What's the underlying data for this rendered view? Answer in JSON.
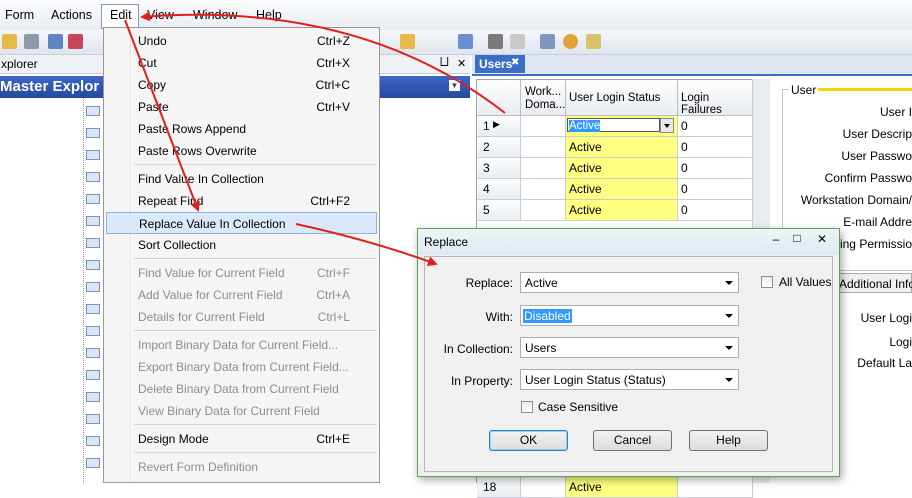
{
  "menubar": {
    "items": [
      "Form",
      "Actions",
      "Edit",
      "View",
      "Window",
      "Help"
    ]
  },
  "explorer": {
    "header_label": "xplorer",
    "pin_glyph": "⨆",
    "close_glyph": "✕",
    "title": "Master Explor",
    "dropdown_glyph": "▼"
  },
  "tabs": {
    "users_label": "Users",
    "close_glyph": "✖"
  },
  "grid": {
    "columns": [
      "",
      "Work... Doma...",
      "User Login Status",
      "Login Failures"
    ],
    "rows": [
      {
        "num": "1",
        "status": "Active",
        "failures": "0"
      },
      {
        "num": "2",
        "status": "Active",
        "failures": "0"
      },
      {
        "num": "3",
        "status": "Active",
        "failures": "0"
      },
      {
        "num": "4",
        "status": "Active",
        "failures": "0"
      },
      {
        "num": "5",
        "status": "Active",
        "failures": "0"
      },
      {
        "num": "18",
        "status": "Active",
        "failures": ""
      }
    ],
    "row_indicator": "▶"
  },
  "user_panel": {
    "group_title": "User",
    "fields": [
      "User I",
      "User Descrip",
      "User Passwo",
      "Confirm Passwo",
      "Workstation Domain/",
      "E-mail Addre",
      "diting Permissio"
    ],
    "additional_tab": "Additional Info",
    "lower_fields": [
      "User Logi",
      "Logi",
      "Default La"
    ]
  },
  "edit_menu": {
    "items": [
      {
        "label": "Undo",
        "shortcut": "Ctrl+Z",
        "disabled": false
      },
      {
        "label": "Cut",
        "shortcut": "Ctrl+X",
        "disabled": false
      },
      {
        "label": "Copy",
        "shortcut": "Ctrl+C",
        "disabled": false
      },
      {
        "label": "Paste",
        "shortcut": "Ctrl+V",
        "disabled": false
      },
      {
        "label": "Paste Rows Append",
        "shortcut": "",
        "disabled": false
      },
      {
        "label": "Paste Rows Overwrite",
        "shortcut": "",
        "disabled": false
      },
      {
        "label": "Find Value In Collection",
        "shortcut": "",
        "disabled": false
      },
      {
        "label": "Repeat Find",
        "shortcut": "Ctrl+F2",
        "disabled": false
      },
      {
        "label": "Replace Value In Collection",
        "shortcut": "",
        "disabled": false
      },
      {
        "label": "Sort Collection",
        "shortcut": "",
        "disabled": false
      },
      {
        "label": "Find Value for Current Field",
        "shortcut": "Ctrl+F",
        "disabled": true
      },
      {
        "label": "Add Value for Current Field",
        "shortcut": "Ctrl+A",
        "disabled": true
      },
      {
        "label": "Details for Current Field",
        "shortcut": "Ctrl+L",
        "disabled": true
      },
      {
        "label": "Import Binary Data for Current Field...",
        "shortcut": "",
        "disabled": true
      },
      {
        "label": "Export Binary Data from Current Field...",
        "shortcut": "",
        "disabled": true
      },
      {
        "label": "Delete Binary Data from Current Field",
        "shortcut": "",
        "disabled": true
      },
      {
        "label": "View Binary Data for Current Field",
        "shortcut": "",
        "disabled": true
      },
      {
        "label": "Design Mode",
        "shortcut": "Ctrl+E",
        "disabled": false
      },
      {
        "label": "Revert Form Definition",
        "shortcut": "",
        "disabled": true
      }
    ]
  },
  "replace_dialog": {
    "title": "Replace",
    "replace_label": "Replace:",
    "replace_value": "Active",
    "with_label": "With:",
    "with_value": "Disabled",
    "collection_label": "In Collection:",
    "collection_value": "Users",
    "property_label": "In Property:",
    "property_value": "User Login Status (Status)",
    "all_values_label": "All Values",
    "case_sensitive_label": "Case Sensitive",
    "ok_label": "OK",
    "cancel_label": "Cancel",
    "help_label": "Help",
    "minimize_glyph": "–",
    "maximize_glyph": "□",
    "close_glyph": "✕"
  },
  "colors": {
    "annotation_arrow": "#e0201e",
    "status_highlight": "#ffff80",
    "selection_blue": "#3399ff"
  }
}
